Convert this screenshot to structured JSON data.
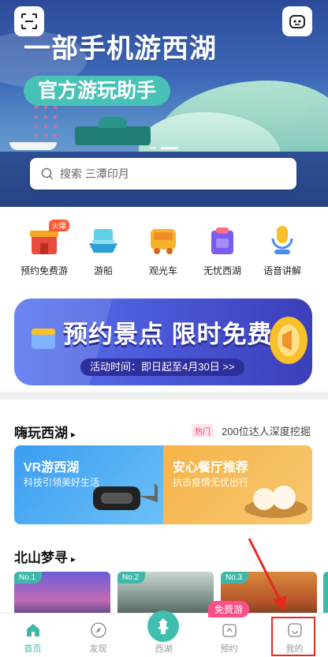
{
  "hero": {
    "title": "一部手机游西湖",
    "subtitle": "官方游玩助手",
    "search_placeholder": "搜索 三潭印月",
    "scan_icon": "scan-icon",
    "chat_icon": "robot-chat-icon"
  },
  "quick_actions": [
    {
      "label": "预约免费游",
      "icon": "temple-gate-icon",
      "badge": "火爆"
    },
    {
      "label": "游船",
      "icon": "boat-icon"
    },
    {
      "label": "观光车",
      "icon": "sightseeing-car-icon"
    },
    {
      "label": "无忧西湖",
      "icon": "shield-bag-icon"
    },
    {
      "label": "语音讲解",
      "icon": "microphone-icon"
    }
  ],
  "promo": {
    "title": "预约景点 限时免费",
    "subtitle": "活动时间：即日起至4月30日 >>"
  },
  "section1": {
    "title": "嗨玩西湖",
    "hot_badge": "热门",
    "hot_text": "200位达人深度挖掘",
    "cards": [
      {
        "title": "VR游西湖",
        "subtitle": "科技引领美好生活"
      },
      {
        "title": "安心餐厅推荐",
        "subtitle": "抗击疫情无忧出行"
      }
    ]
  },
  "section2": {
    "title": "北山梦寻",
    "items": [
      {
        "rank": "No.1"
      },
      {
        "rank": "No.2"
      },
      {
        "rank": "No.3"
      }
    ]
  },
  "tabbar": {
    "free_badge": "免费游",
    "tabs": [
      {
        "label": "首页",
        "icon": "home-icon",
        "active": true
      },
      {
        "label": "发现",
        "icon": "compass-icon",
        "active": false
      },
      {
        "label": "西湖",
        "icon": "pagoda-icon",
        "active": false
      },
      {
        "label": "预约",
        "icon": "ticket-icon",
        "active": false
      },
      {
        "label": "我的",
        "icon": "profile-icon",
        "active": false
      }
    ]
  },
  "colors": {
    "accent": "#3cb8a9",
    "hot": "#ff5a36",
    "highlight": "#e8281f"
  }
}
